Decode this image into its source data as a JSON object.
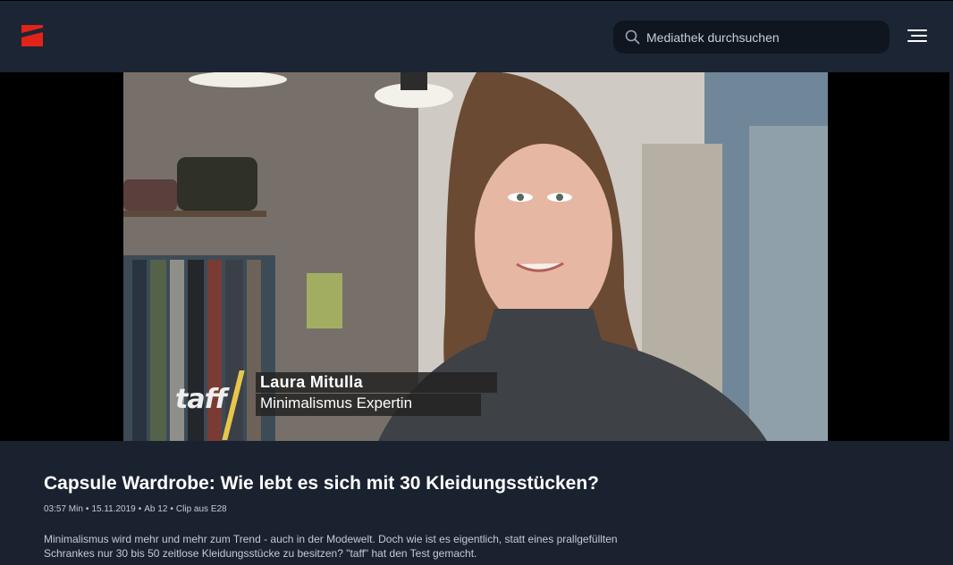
{
  "header": {
    "logo_icon": "prosieben-logo-icon",
    "search": {
      "placeholder": "Mediathek durchsuchen",
      "icon": "search-icon"
    },
    "menu_icon": "hamburger-menu-icon",
    "background": "#1c2533",
    "logo_color": "#e2231a"
  },
  "video": {
    "lower_third": {
      "show_logo": "taff",
      "name": "Laura Mitulla",
      "role": "Minimalismus Expertin",
      "accent": "#e7c64a"
    }
  },
  "clip": {
    "title": "Capsule Wardrobe: Wie lebt es sich mit 30 Kleidungsstücken?",
    "meta": [
      "03:57 Min",
      "15.11.2019",
      "Ab 12",
      "Clip aus E28"
    ],
    "description": "Minimalismus wird mehr und mehr zum Trend - auch in der Modewelt. Doch wie ist es eigentlich, statt eines prallgefüllten Schrankes nur 30 bis 50 zeitlose Kleidungsstücke zu besitzen? \"taff\" hat den Test gemacht."
  }
}
